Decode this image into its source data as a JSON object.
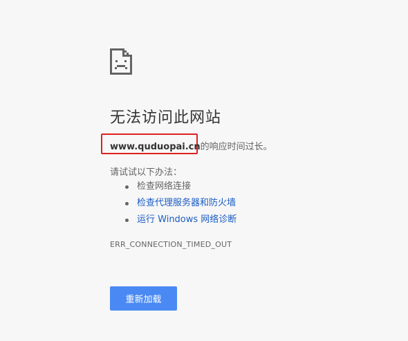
{
  "error": {
    "icon": "sad-page-icon",
    "title": "无法访问此网站",
    "host": "www.quduopai.cn",
    "message_suffix": "的响应时间过长。",
    "suggestions_heading": "请试试以下办法：",
    "suggestions": [
      {
        "label": "检查网络连接",
        "is_link": false
      },
      {
        "label": "检查代理服务器和防火墙",
        "is_link": true
      },
      {
        "label": "运行 Windows 网络诊断",
        "is_link": true
      }
    ],
    "error_code": "ERR_CONNECTION_TIMED_OUT",
    "reload_label": "重新加载"
  },
  "colors": {
    "background": "#f7f7f7",
    "button": "#4a89f3",
    "link": "#1a5cc4",
    "highlight": "#e02020"
  }
}
